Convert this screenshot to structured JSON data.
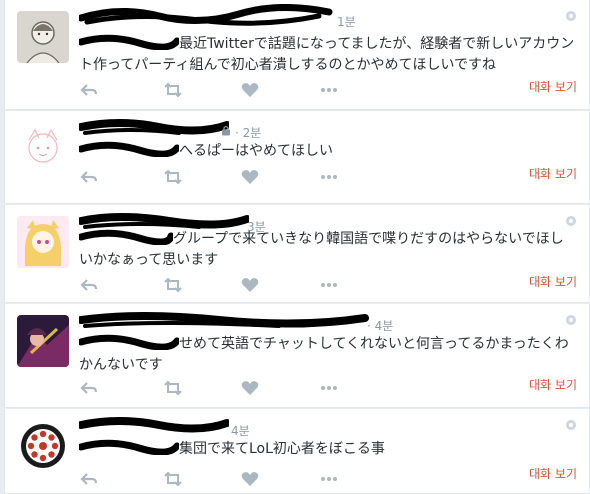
{
  "tweets": [
    {
      "time": "1분",
      "text": "最近Twitterで話題になってましたが、経験者で新しいアカウント作ってパーティ組んで初心者潰しするのとかやめてほしいですね",
      "convo": "대화 보기",
      "protected": false
    },
    {
      "time": "· 2분",
      "text": "へるぱーはやめてほしい",
      "convo": "대화 보기",
      "protected": true
    },
    {
      "time": "3분",
      "text": "グループで来ていきなり韓国語で喋りだすのはやらないでほしいかなぁって思います",
      "convo": "대화 보기",
      "protected": false
    },
    {
      "time": "· 4분",
      "text": "せめて英語でチャットしてくれないと何言ってるかまったくわかんないです",
      "convo": "대화 보기",
      "protected": false
    },
    {
      "time": "4분",
      "text": "集団で来てLoL初心者をぼこる事",
      "convo": "대화 보기",
      "protected": false
    }
  ],
  "icons": {
    "reply": "reply-icon",
    "retweet": "retweet-icon",
    "like": "heart-icon",
    "more": "more-dots-icon"
  },
  "colors": {
    "action_gray": "#aab8c2",
    "convo_link": "#d8553a",
    "time_gray": "#8899a6"
  }
}
